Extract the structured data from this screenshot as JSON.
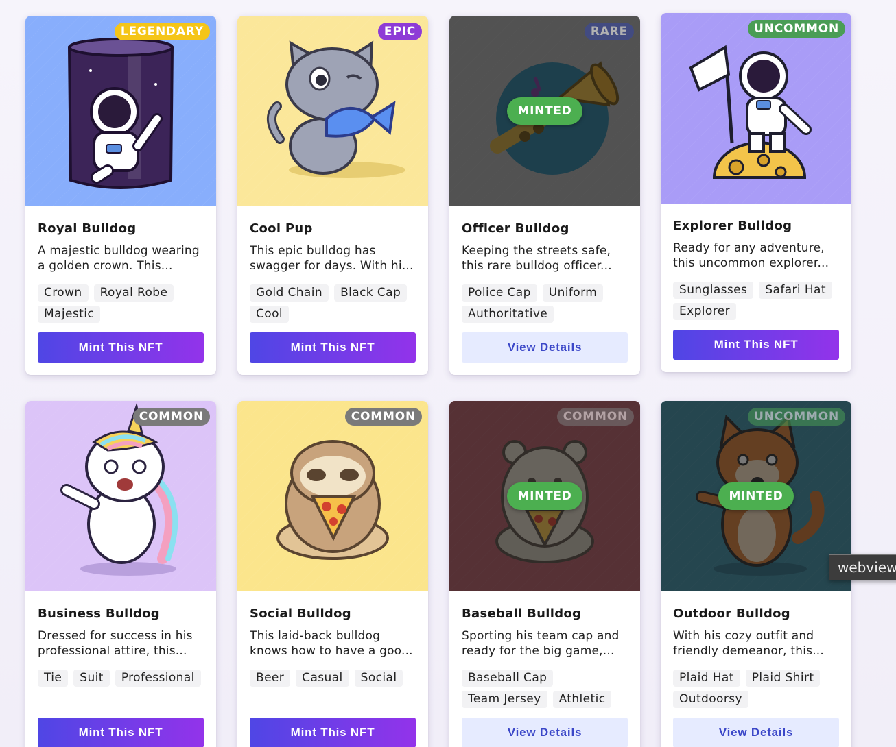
{
  "cards": [
    {
      "name": "Royal Bulldog",
      "description": "A majestic bulldog wearing a golden crown. This...",
      "rarity": "LEGENDARY",
      "rarity_color": "#f5c518",
      "art_bg": "#88aefc",
      "illustration": "astronaut-in-glass-icon",
      "tags": [
        "Crown",
        "Royal Robe",
        "Majestic"
      ],
      "minted": false,
      "button_label": "Mint This NFT"
    },
    {
      "name": "Cool Pup",
      "description": "This epic bulldog has swagger for days. With hi...",
      "rarity": "EPIC",
      "rarity_color": "#8e3bd6",
      "art_bg": "#fbe79a",
      "illustration": "cat-with-fish-icon",
      "tags": [
        "Gold Chain",
        "Black Cap",
        "Cool"
      ],
      "minted": false,
      "button_label": "Mint This NFT"
    },
    {
      "name": "Officer Bulldog",
      "description": "Keeping the streets safe, this rare bulldog officer...",
      "rarity": "RARE",
      "rarity_color": "#3547a8",
      "art_bg": "#a8a8a8",
      "illustration": "trumpet-icon",
      "tags": [
        "Police Cap",
        "Uniform",
        "Authoritative"
      ],
      "minted": true,
      "minted_label": "MINTED",
      "button_label": "View Details"
    },
    {
      "name": "Explorer Bulldog",
      "description": "Ready for any adventure, this uncommon explorer...",
      "rarity": "UNCOMMON",
      "rarity_color": "#4a9d55",
      "art_bg": "#a99cf7",
      "illustration": "astronaut-on-moon-icon",
      "tags": [
        "Sunglasses",
        "Safari Hat",
        "Explorer"
      ],
      "minted": false,
      "button_label": "Mint This NFT"
    },
    {
      "name": "Business Bulldog",
      "description": "Dressed for success in his professional attire, this...",
      "rarity": "COMMON",
      "rarity_color": "#7a7a7a",
      "art_bg": "#dcc4f8",
      "illustration": "zombie-unicorn-icon",
      "tags": [
        "Tie",
        "Suit",
        "Professional"
      ],
      "minted": false,
      "button_label": "Mint This NFT"
    },
    {
      "name": "Social Bulldog",
      "description": "This laid-back bulldog knows how to have a goo...",
      "rarity": "COMMON",
      "rarity_color": "#7a7a7a",
      "art_bg": "#fbe58c",
      "illustration": "sloth-eating-pizza-icon",
      "tags": [
        "Beer",
        "Casual",
        "Social"
      ],
      "minted": false,
      "button_label": "Mint This NFT"
    },
    {
      "name": "Baseball Bulldog",
      "description": "Sporting his team cap and ready for the big game,...",
      "rarity": "COMMON",
      "rarity_color": "#7a7a7a",
      "art_bg": "#b05863",
      "illustration": "bear-eating-pizza-icon",
      "tags": [
        "Baseball Cap",
        "Team Jersey",
        "Athletic"
      ],
      "minted": true,
      "minted_label": "MINTED",
      "button_label": "View Details"
    },
    {
      "name": "Outdoor Bulldog",
      "description": "With his cozy outfit and friendly demeanor, this...",
      "rarity": "UNCOMMON",
      "rarity_color": "#4a9d55",
      "art_bg": "#3d8aa0",
      "illustration": "zombie-shiba-icon",
      "tags": [
        "Plaid Hat",
        "Plaid Shirt",
        "Outdoorsy"
      ],
      "minted": true,
      "minted_label": "MINTED",
      "button_label": "View Details"
    }
  ],
  "tooltip": {
    "text": "webview"
  }
}
